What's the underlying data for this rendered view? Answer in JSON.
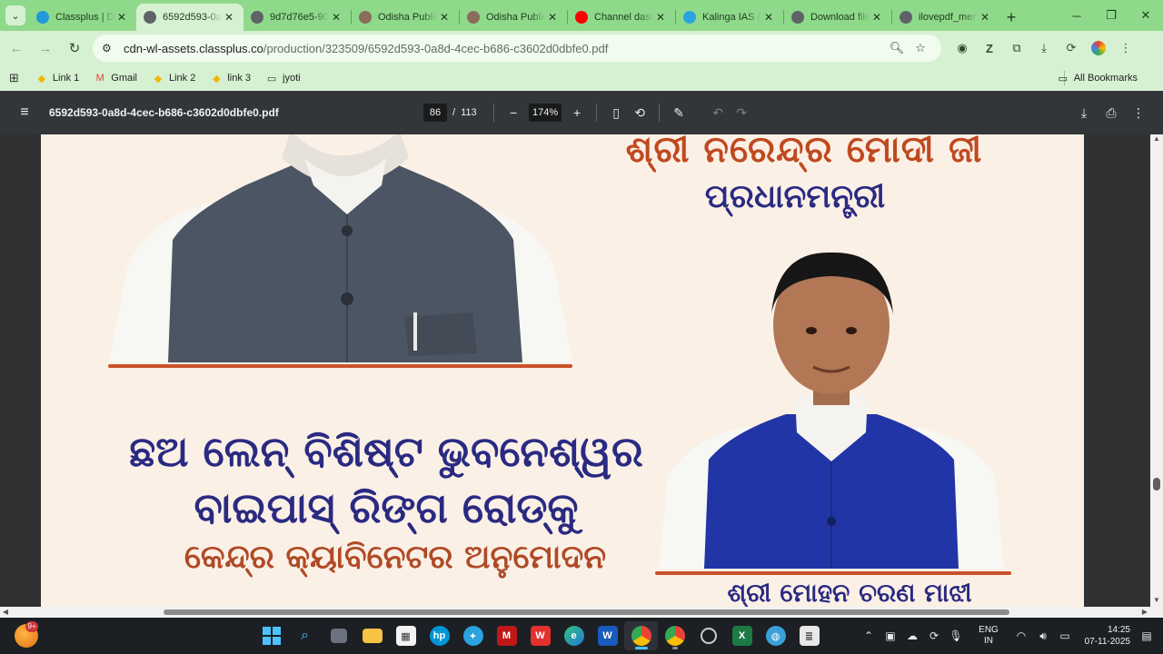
{
  "browser": {
    "tabs": [
      {
        "title": "Classplus | DI",
        "favicon_color": "#1f9ad6",
        "active": false
      },
      {
        "title": "6592d593-0a",
        "favicon_color": "#5f6368",
        "active": true
      },
      {
        "title": "9d7d76e5-90",
        "favicon_color": "#5f6368",
        "active": false
      },
      {
        "title": "Odisha Public",
        "favicon_color": "#8a6d5a",
        "active": false
      },
      {
        "title": "Odisha Public",
        "favicon_color": "#8a6d5a",
        "active": false
      },
      {
        "title": "Channel dash",
        "favicon_color": "#ff0000",
        "active": false
      },
      {
        "title": "Kalinga IAS /",
        "favicon_color": "#2aa3e0",
        "active": false
      },
      {
        "title": "Download file",
        "favicon_color": "#5f6368",
        "active": false
      },
      {
        "title": "ilovepdf_mer",
        "favicon_color": "#5f6368",
        "active": false
      }
    ],
    "url_host": "cdn-wl-assets.classplus.co",
    "url_path": "/production/323509/6592d593-0a8d-4cec-b686-c3602d0dbfe0.pdf",
    "bookmarks": [
      {
        "label": "Link 1",
        "icon": "classplus-icon",
        "color": "#f4b400"
      },
      {
        "label": "Gmail",
        "icon": "gmail-icon",
        "color": "#ea4335"
      },
      {
        "label": "Link 2",
        "icon": "classplus-icon",
        "color": "#f4b400"
      },
      {
        "label": "link 3",
        "icon": "classplus-icon",
        "color": "#f4b400"
      },
      {
        "label": "jyoti",
        "icon": "folder-icon",
        "color": "#3c4043"
      }
    ],
    "all_bookmarks": "All Bookmarks"
  },
  "pdf": {
    "filename": "6592d593-0a8d-4cec-b686-c3602d0dbfe0.pdf",
    "current_page": "86",
    "page_sep": "/",
    "total_pages": "113",
    "zoom": "174%",
    "scroll": {
      "vertical_fraction": 0.76,
      "horizontal_start": 0.135,
      "horizontal_fraction": 0.75
    }
  },
  "document": {
    "modi_name": "ଶ୍ରୀ ନରେନ୍ଦ୍ର ମୋଦୀ ଜୀ",
    "modi_title": "ପ୍ରଧାନମନ୍ତ୍ରୀ",
    "headline_line1": "ଛଅ ଲେନ୍ ବିଶିଷ୍ଟ ଭୁବନେଶ୍ୱର",
    "headline_line2": "ବାଇପାସ୍ ରିଙ୍ଗ ରୋଡ୍‌କୁ",
    "headline_line3": "କେନ୍ଦ୍ର କ୍ୟାବିନେଟର ଅନୁମୋଦନ",
    "majhi_name": "ଶ୍ରୀ ମୋହନ ଚରଣ ମାଝୀ"
  },
  "taskbar": {
    "widget_badge": "9+",
    "lang_line1": "ENG",
    "lang_line2": "IN",
    "time": "14:25",
    "date": "07-11-2025"
  }
}
